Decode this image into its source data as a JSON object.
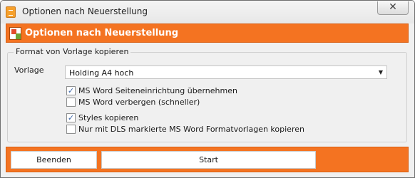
{
  "window": {
    "title": "Optionen nach Neuerstellung",
    "close_glyph": "✕"
  },
  "header": {
    "title": "Optionen nach Neuerstellung"
  },
  "group": {
    "legend": "Format von Vorlage kopieren",
    "vorlage_label": "Vorlage",
    "vorlage_value": "Holding A4 hoch",
    "options": [
      {
        "label": "MS Word Seiteneinrichtung übernehmen",
        "checked": true
      },
      {
        "label": "MS Word verbergen (schneller)",
        "checked": false
      },
      {
        "label": "Styles kopieren",
        "checked": true
      },
      {
        "label": "Nur mit DLS markierte MS Word Formatvorlagen kopieren",
        "checked": false
      }
    ]
  },
  "footer": {
    "beenden_label": "Beenden",
    "start_label": "Start"
  },
  "colors": {
    "accent": "#f47321",
    "check": "#3b66a8"
  },
  "icons": {
    "app": "document-icon",
    "header": "template-icon",
    "close": "close-icon",
    "dropdown": "chevron-down-icon",
    "check": "checkmark-icon"
  }
}
